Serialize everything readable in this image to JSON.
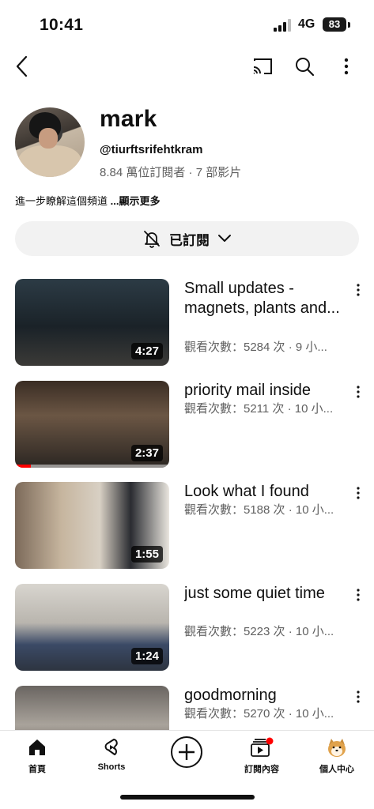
{
  "status_bar": {
    "time": "10:41",
    "network": "4G",
    "battery": "83"
  },
  "channel": {
    "name": "mark",
    "handle": "@tiurftsrifehtkram",
    "stats": "8.84 萬位訂閱者 · 7 部影片",
    "description": "進一步瞭解這個頻道 ",
    "more_label": "...顯示更多",
    "subscribe_label": "已訂閱"
  },
  "videos": [
    {
      "title": "Small updates - magnets, plants and...",
      "meta": "觀看次數：5284 次 · 9 小...",
      "duration": "4:27"
    },
    {
      "title": "priority mail inside",
      "meta": "觀看次數：5211 次 · 10 小...",
      "duration": "2:37",
      "progress": 0.1
    },
    {
      "title": "Look what I found",
      "meta": "觀看次數：5188 次 · 10 小...",
      "duration": "1:55"
    },
    {
      "title": "just some quiet time",
      "meta": "觀看次數：5223 次 · 10 小...",
      "duration": "1:24"
    },
    {
      "title": "goodmorning",
      "meta": "觀看次數：5270 次 · 10 小...",
      "duration": ""
    }
  ],
  "bottom_nav": {
    "home": "首頁",
    "shorts": "Shorts",
    "subscriptions": "訂閱內容",
    "you": "個人中心"
  },
  "colors": {
    "accent_red": "#ff0000",
    "secondary_text": "#606060",
    "pill_bg": "#f2f2f2"
  }
}
